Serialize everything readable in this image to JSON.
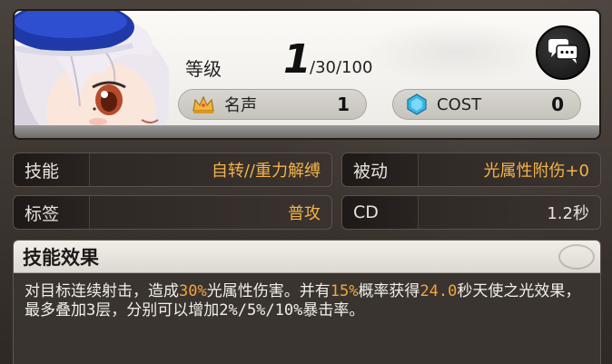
{
  "header": {
    "level_label": "等级",
    "level_value": "1",
    "level_max": "/30/100",
    "fame_label": "名声",
    "fame_value": "1",
    "cost_label": "COST",
    "cost_value": "0",
    "icons": {
      "fame": "crown-icon",
      "cost": "gem-icon",
      "chat": "chat-bubbles-icon"
    }
  },
  "stats": {
    "skill_label": "技能",
    "skill_value": "自转//重力解缚",
    "passive_label": "被动",
    "passive_value": "光属性附伤+0",
    "tag_label": "标签",
    "tag_value": "普攻",
    "cd_label": "CD",
    "cd_value": "1.2秒"
  },
  "effect": {
    "title": "技能效果",
    "segments": [
      {
        "text": "对目标连续射击，造成",
        "highlight": false
      },
      {
        "text": "30%",
        "highlight": true
      },
      {
        "text": "光属性伤害。并有",
        "highlight": false
      },
      {
        "text": "15%",
        "highlight": true
      },
      {
        "text": "概率获得",
        "highlight": false
      },
      {
        "text": "24.0",
        "highlight": true
      },
      {
        "text": "秒天使之光效果，最多叠加3层，分别可以增加2%/5%/10%暴击率。",
        "highlight": false
      }
    ]
  },
  "colors": {
    "accent": "#f3a63a",
    "panel": "#3a3431"
  }
}
